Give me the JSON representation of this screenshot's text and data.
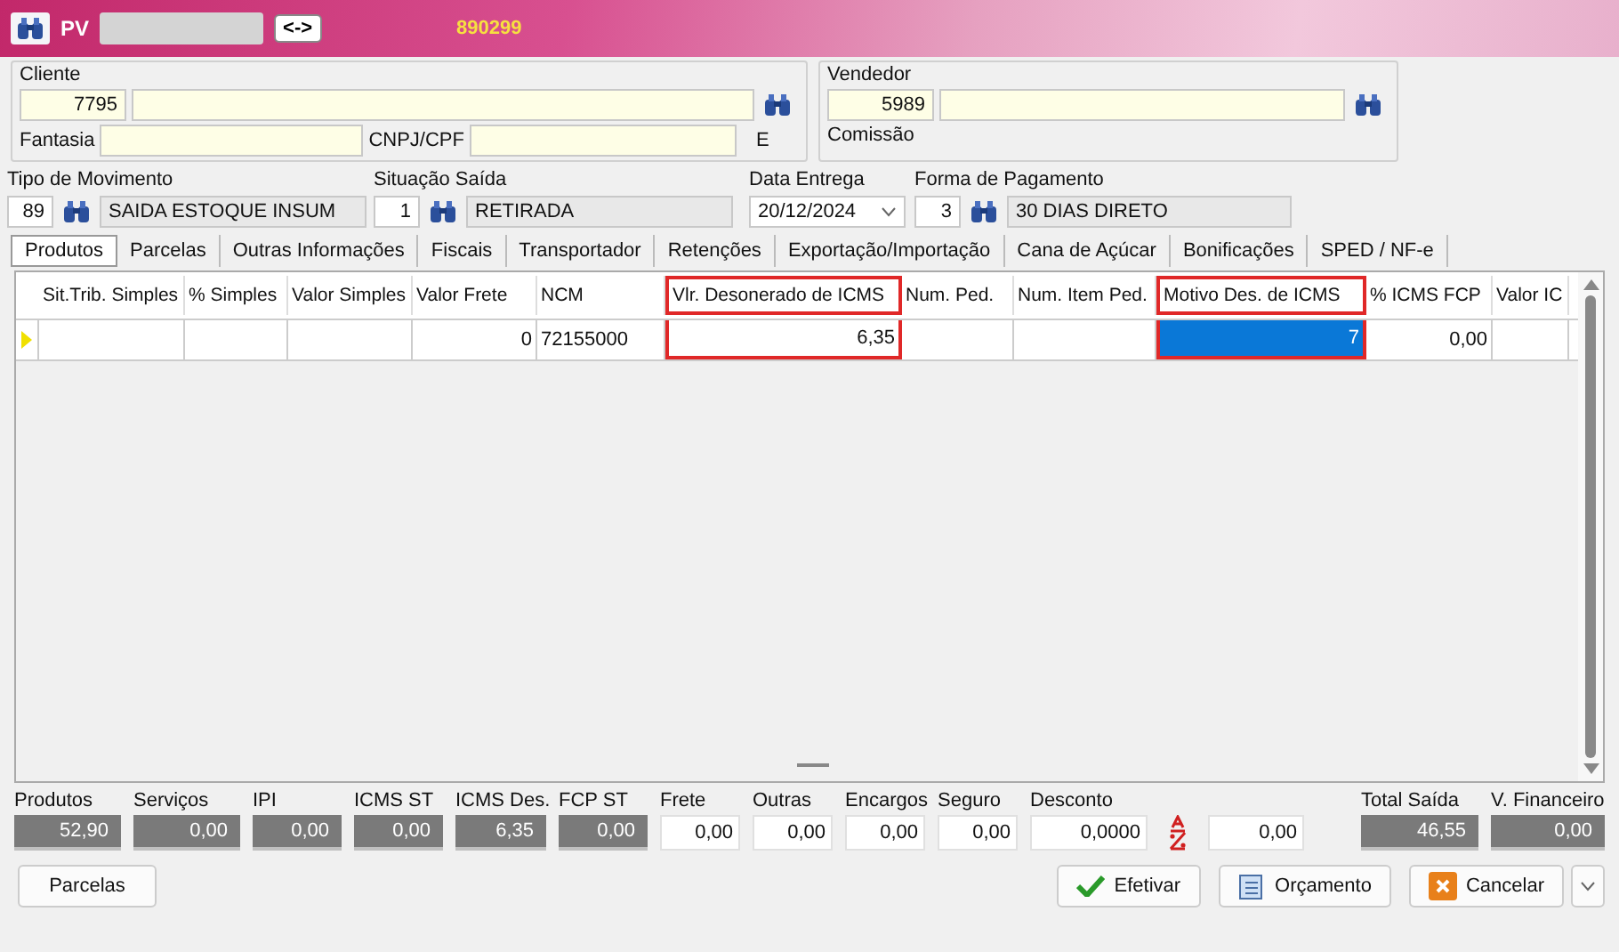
{
  "header": {
    "title": "PV",
    "swap_button": "<->",
    "number": "890299"
  },
  "cliente": {
    "label": "Cliente",
    "code": "7795",
    "fantasia_label": "Fantasia",
    "cnpj_label": "CNPJ/CPF",
    "e_label": "E"
  },
  "vendedor": {
    "label": "Vendedor",
    "code": "5989",
    "comissao_label": "Comissão"
  },
  "fields": [
    {
      "kind": "lookup",
      "label": "Tipo  de Movimento",
      "code": "89",
      "description": "SAIDA ESTOQUE INSUM"
    },
    {
      "kind": "lookup",
      "label": "Situação Saída",
      "code": "1",
      "description": "RETIRADA"
    },
    {
      "kind": "date",
      "label": "Data Entrega",
      "value": "20/12/2024"
    },
    {
      "kind": "lookup",
      "label": "Forma de Pagamento",
      "code": "3",
      "description": "30 DIAS DIRETO"
    }
  ],
  "tabs": [
    {
      "label": "Produtos",
      "selected": true
    },
    {
      "label": "Parcelas",
      "selected": false
    },
    {
      "label": "Outras Informações",
      "selected": false
    },
    {
      "label": "Fiscais",
      "selected": false
    },
    {
      "label": "Transportador",
      "selected": false
    },
    {
      "label": "Retenções",
      "selected": false
    },
    {
      "label": "Exportação/Importação",
      "selected": false
    },
    {
      "label": "Cana de Açúcar",
      "selected": false
    },
    {
      "label": "Bonificações",
      "selected": false
    },
    {
      "label": "SPED / NF-e",
      "selected": false
    }
  ],
  "grid": {
    "columns": [
      {
        "header": "Sit.Trib. Simples",
        "highlighted": false
      },
      {
        "header": "% Simples",
        "highlighted": false
      },
      {
        "header": "Valor Simples",
        "highlighted": false
      },
      {
        "header": "Valor Frete",
        "highlighted": false
      },
      {
        "header": "NCM",
        "highlighted": false
      },
      {
        "header": "Vlr. Desonerado de ICMS",
        "highlighted": true
      },
      {
        "header": "Num. Ped.",
        "highlighted": false
      },
      {
        "header": "Num. Item Ped.",
        "highlighted": false
      },
      {
        "header": "Motivo Des. de ICMS",
        "highlighted": true
      },
      {
        "header": "% ICMS FCP",
        "highlighted": false
      },
      {
        "header": "Valor IC",
        "highlighted": false
      }
    ],
    "rows": [
      {
        "current": true,
        "cells": [
          {
            "selected": false
          },
          {
            "selected": false
          },
          {
            "selected": false
          },
          {
            "text": "0",
            "selected": false
          },
          {
            "text": "72155000",
            "selected": false
          },
          {
            "text": "6,35",
            "selected": false
          },
          {
            "selected": false
          },
          {
            "selected": false
          },
          {
            "text": "7",
            "selected": true
          },
          {
            "text": "0,00",
            "selected": false
          },
          {
            "selected": false
          }
        ]
      }
    ]
  },
  "totals": [
    {
      "kind": "readonly",
      "label": "Produtos",
      "value": "52,90"
    },
    {
      "kind": "readonly",
      "label": "Serviços",
      "value": "0,00"
    },
    {
      "kind": "readonly",
      "label": "IPI",
      "value": "0,00"
    },
    {
      "kind": "readonly",
      "label": "ICMS ST",
      "value": "0,00"
    },
    {
      "kind": "readonly",
      "label": "ICMS Des.",
      "value": "6,35"
    },
    {
      "kind": "readonly",
      "label": "FCP ST",
      "value": "0,00"
    },
    {
      "kind": "input",
      "label": "Frete",
      "value": "0,00"
    },
    {
      "kind": "input",
      "label": "Outras",
      "value": "0,00"
    },
    {
      "kind": "input",
      "label": "Encargos",
      "value": "0,00"
    },
    {
      "kind": "input",
      "label": "Seguro",
      "value": "0,00"
    },
    {
      "kind": "input",
      "label": "Desconto",
      "value": "0,0000"
    },
    {
      "kind": "toggle"
    },
    {
      "kind": "input",
      "value": "0,00"
    },
    {
      "kind": "gap"
    },
    {
      "kind": "readonly",
      "label": "Total Saída",
      "value": "46,55"
    },
    {
      "kind": "readonly",
      "label": "V. Financeiro",
      "value": "0,00"
    }
  ],
  "parcelas_button": "Parcelas",
  "buttons": [
    {
      "kind": "confirm",
      "label": "Efetivar"
    },
    {
      "kind": "quote",
      "label": "Orçamento"
    },
    {
      "kind": "cancel",
      "label": "Cancelar"
    }
  ]
}
